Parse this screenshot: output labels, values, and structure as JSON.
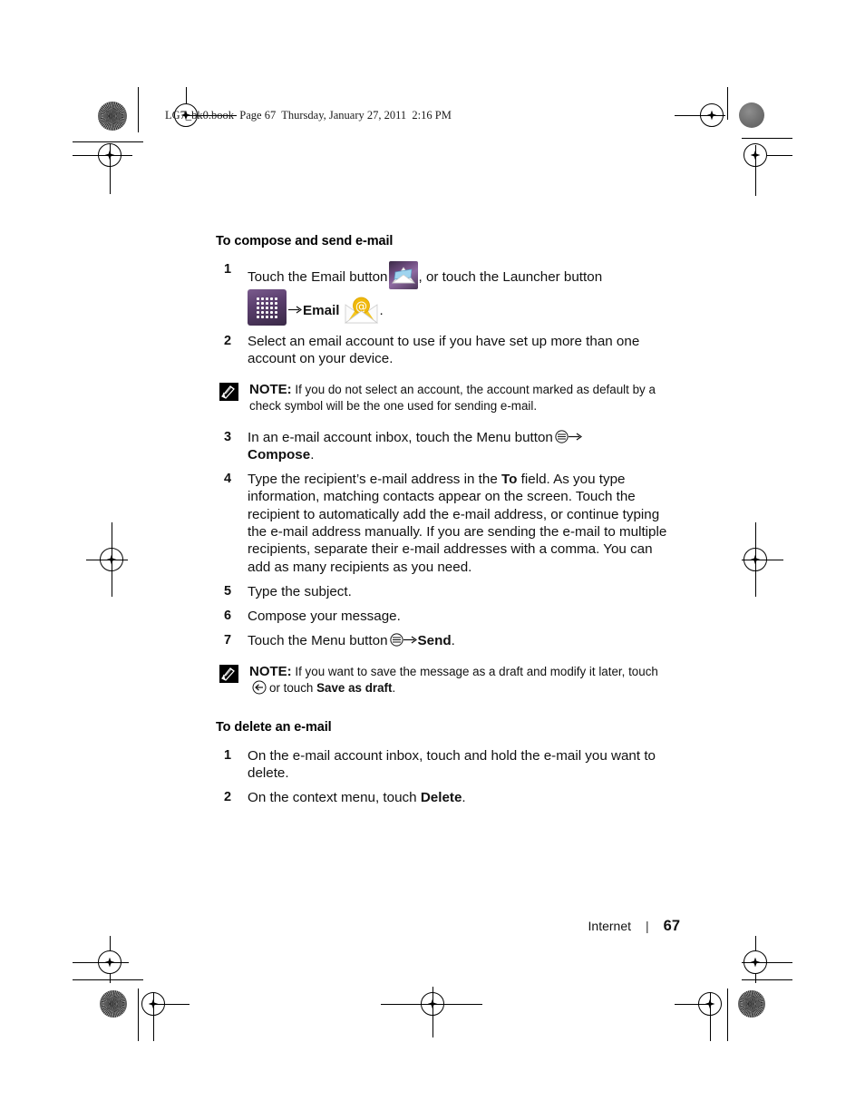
{
  "print_header": {
    "text": "LG7_bk0.book  Page 67  Thursday, January 27, 2011  2:16 PM"
  },
  "sections": [
    {
      "heading": "To compose and send e-mail",
      "steps": {
        "n1": "1",
        "n2": "2",
        "n3": "3",
        "n4": "4",
        "n5": "5",
        "n6": "6",
        "n7": "7",
        "s1_a": "Touch the Email button",
        "s1_b": ", or touch the Launcher button",
        "s1_c": "Email",
        "s1_d": ".",
        "s2": "Select an email account to use if you have set up more than one account on your device.",
        "s3_a": "In an e-mail account inbox, touch the Menu button",
        "s3_b": "Compose",
        "s3_c": ".",
        "s4_a": "Type the recipient’s e-mail address in the ",
        "s4_b": "To",
        "s4_c": " field. As you type information, matching contacts appear on the screen. Touch the recipient to automatically add the e-mail address, or continue typing the e-mail address manually. If you are sending the e-mail to multiple recipients, separate their e-mail addresses with a comma. You can add as many recipients as you need.",
        "s5": "Type the subject.",
        "s6": "Compose your message.",
        "s7_a": "Touch the Menu button",
        "s7_b": "Send",
        "s7_c": "."
      }
    },
    {
      "heading": "To delete an e-mail",
      "steps": {
        "n1": "1",
        "n2": "2",
        "d1": "On the e-mail account inbox, touch and hold the e-mail you want to delete.",
        "d2_a": "On the context menu, touch ",
        "d2_b": "Delete",
        "d2_c": "."
      }
    }
  ],
  "notes": [
    {
      "label": "NOTE:",
      "text": " If you do not select an account, the account marked as default by a check symbol will be the one used for sending e-mail."
    },
    {
      "label": "NOTE:",
      "text_a": " If you want to save the message as a draft and modify it later, touch",
      "text_b": "or touch ",
      "text_c": "Save as draft",
      "text_d": "."
    }
  ],
  "footer": {
    "chapter": "Internet",
    "separator": "|",
    "page_number": "67"
  },
  "icons": {
    "email_button": "email-button-icon",
    "launcher_button": "launcher-button-icon",
    "email_app": "email-app-icon",
    "menu_button": "menu-button-icon",
    "arrow_right": "arrow-right-icon",
    "back_button": "back-button-icon",
    "note": "note-pencil-icon"
  },
  "colors": {
    "launcher_purple": "#5b3f6e",
    "email_app_gold": "#f2c01e",
    "text": "#111111"
  }
}
